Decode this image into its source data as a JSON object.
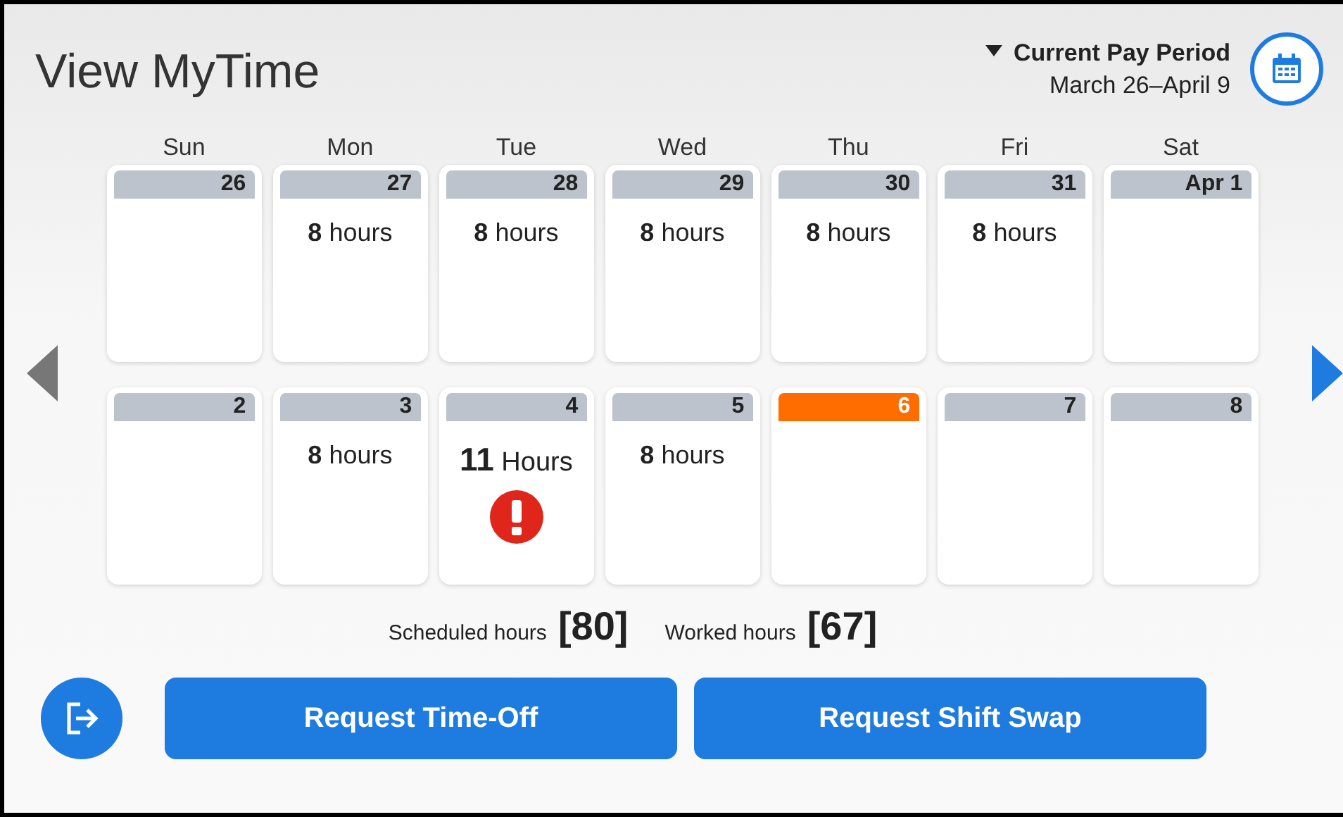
{
  "title": "View MyTime",
  "pay_period": {
    "label": "Current Pay Period",
    "range": "March 26–April 9"
  },
  "weekdays": [
    "Sun",
    "Mon",
    "Tue",
    "Wed",
    "Thu",
    "Fri",
    "Sat"
  ],
  "nav": {
    "prev_disabled": true,
    "next_disabled": false
  },
  "weeks": [
    [
      {
        "date": "26",
        "today": false,
        "alert": false
      },
      {
        "date": "27",
        "hours": "8",
        "unit": "hours",
        "today": false,
        "alert": false
      },
      {
        "date": "28",
        "hours": "8",
        "unit": "hours",
        "today": false,
        "alert": false
      },
      {
        "date": "29",
        "hours": "8",
        "unit": "hours",
        "today": false,
        "alert": false
      },
      {
        "date": "30",
        "hours": "8",
        "unit": "hours",
        "today": false,
        "alert": false
      },
      {
        "date": "31",
        "hours": "8",
        "unit": "hours",
        "today": false,
        "alert": false
      },
      {
        "date": "Apr 1",
        "today": false,
        "alert": false
      }
    ],
    [
      {
        "date": "2",
        "today": false,
        "alert": false
      },
      {
        "date": "3",
        "hours": "8",
        "unit": "hours",
        "today": false,
        "alert": false
      },
      {
        "date": "4",
        "hours": "11",
        "unit": "Hours",
        "today": false,
        "alert": true
      },
      {
        "date": "5",
        "hours": "8",
        "unit": "hours",
        "today": false,
        "alert": false
      },
      {
        "date": "6",
        "today": true,
        "alert": false
      },
      {
        "date": "7",
        "today": false,
        "alert": false
      },
      {
        "date": "8",
        "today": false,
        "alert": false
      }
    ]
  ],
  "totals": [
    {
      "label": "Scheduled hours",
      "value": "[80]"
    },
    {
      "label": "Worked hours",
      "value": "[67]"
    }
  ],
  "buttons": [
    "Request Time-Off",
    "Request Shift Swap"
  ]
}
